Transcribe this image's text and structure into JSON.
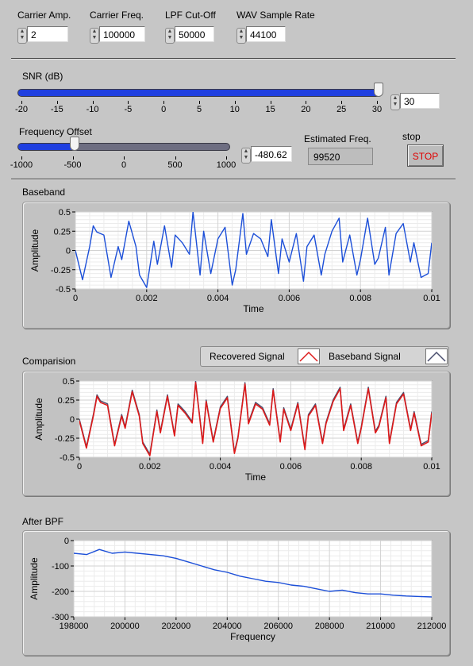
{
  "controls": [
    {
      "label": "Carrier Amp.",
      "value": "2"
    },
    {
      "label": "Carrier Freq.",
      "value": "100000"
    },
    {
      "label": "LPF Cut-Off",
      "value": "50000"
    },
    {
      "label": "WAV Sample Rate",
      "value": "44100"
    }
  ],
  "snr": {
    "label": "SNR (dB)",
    "value": "30",
    "min": -20,
    "max": 30,
    "current": 30,
    "ticks": [
      "-20",
      "-15",
      "-10",
      "-5",
      "0",
      "5",
      "10",
      "15",
      "20",
      "25",
      "30"
    ]
  },
  "freq_offset": {
    "label": "Frequency Offset",
    "value": "-480.62",
    "min": -1000,
    "max": 1000,
    "current": -480.62,
    "ticks": [
      "-1000",
      "-500",
      "0",
      "500",
      "1000"
    ]
  },
  "estimated": {
    "label": "Estimated Freq.",
    "value": "99520"
  },
  "stop": {
    "label": "stop",
    "button": "STOP"
  },
  "colors": {
    "signal": "#1c4fd8",
    "recovered": "#dd1a1a",
    "baseband": "#4a4e6e",
    "slider": "#1f3fe0"
  },
  "chart_data": [
    {
      "type": "line",
      "title": "Baseband",
      "xlabel": "Time",
      "ylabel": "Amplitude",
      "xlim": [
        0,
        0.01
      ],
      "ylim": [
        -0.5,
        0.5
      ],
      "xticks": [
        "0",
        "0.002",
        "0.004",
        "0.006",
        "0.008",
        "0.01"
      ],
      "yticks": [
        "0.5",
        "0.25",
        "0",
        "-0.25",
        "-0.5"
      ],
      "grid": true,
      "series": [
        {
          "x": [
            0,
            0.0002,
            0.0004,
            0.0005,
            0.0006,
            0.0008,
            0.001,
            0.0012,
            0.0013,
            0.0015,
            0.0017,
            0.0018,
            0.002,
            0.0022,
            0.0023,
            0.0025,
            0.0027,
            0.0028,
            0.003,
            0.0032,
            0.0033,
            0.0035,
            0.0036,
            0.0038,
            0.004,
            0.0042,
            0.0044,
            0.0045,
            0.0047,
            0.0048,
            0.005,
            0.0052,
            0.0054,
            0.0055,
            0.0057,
            0.0058,
            0.006,
            0.0062,
            0.0064,
            0.0065,
            0.0067,
            0.0069,
            0.007,
            0.0072,
            0.0074,
            0.0075,
            0.0077,
            0.0079,
            0.008,
            0.0082,
            0.0084,
            0.0085,
            0.0087,
            0.0088,
            0.009,
            0.0092,
            0.0094,
            0.0095,
            0.0097,
            0.0099,
            0.01
          ],
          "y": [
            0,
            -0.38,
            0.05,
            0.32,
            0.24,
            0.2,
            -0.35,
            0.05,
            -0.12,
            0.38,
            0.05,
            -0.32,
            -0.48,
            0.12,
            -0.18,
            0.32,
            -0.22,
            0.2,
            0.1,
            -0.05,
            0.5,
            -0.32,
            0.25,
            -0.3,
            0.15,
            0.3,
            -0.45,
            -0.25,
            0.48,
            -0.05,
            0.22,
            0.15,
            -0.08,
            0.4,
            -0.3,
            0.15,
            -0.15,
            0.22,
            -0.4,
            0.05,
            0.2,
            -0.32,
            -0.05,
            0.25,
            0.42,
            -0.15,
            0.2,
            -0.32,
            -0.12,
            0.42,
            -0.18,
            -0.1,
            0.3,
            -0.32,
            0.22,
            0.35,
            -0.15,
            0.1,
            -0.35,
            -0.3,
            0.1
          ]
        }
      ]
    },
    {
      "type": "line",
      "title": "Comparision",
      "xlabel": "Time",
      "ylabel": "Amplitude",
      "xlim": [
        0,
        0.01
      ],
      "ylim": [
        -0.5,
        0.5
      ],
      "xticks": [
        "0",
        "0.002",
        "0.004",
        "0.006",
        "0.008",
        "0.01"
      ],
      "yticks": [
        "0.5",
        "0.25",
        "0",
        "-0.25",
        "-0.5"
      ],
      "grid": true,
      "legend": "top-right",
      "series": [
        {
          "name": "Recovered Signal",
          "x": [
            0,
            0.0002,
            0.0004,
            0.0005,
            0.0006,
            0.0008,
            0.001,
            0.0012,
            0.0013,
            0.0015,
            0.0017,
            0.0018,
            0.002,
            0.0022,
            0.0023,
            0.0025,
            0.0027,
            0.0028,
            0.003,
            0.0032,
            0.0033,
            0.0035,
            0.0036,
            0.0038,
            0.004,
            0.0042,
            0.0044,
            0.0045,
            0.0047,
            0.0048,
            0.005,
            0.0052,
            0.0054,
            0.0055,
            0.0057,
            0.0058,
            0.006,
            0.0062,
            0.0064,
            0.0065,
            0.0067,
            0.0069,
            0.007,
            0.0072,
            0.0074,
            0.0075,
            0.0077,
            0.0079,
            0.008,
            0.0082,
            0.0084,
            0.0085,
            0.0087,
            0.0088,
            0.009,
            0.0092,
            0.0094,
            0.0095,
            0.0097,
            0.0099,
            0.01
          ],
          "y": [
            -0.02,
            -0.38,
            0.05,
            0.3,
            0.22,
            0.18,
            -0.35,
            0.04,
            -0.12,
            0.36,
            0.04,
            -0.32,
            -0.48,
            0.1,
            -0.18,
            0.3,
            -0.22,
            0.18,
            0.08,
            -0.05,
            0.48,
            -0.32,
            0.23,
            -0.3,
            0.14,
            0.28,
            -0.45,
            -0.25,
            0.46,
            -0.06,
            0.2,
            0.13,
            -0.08,
            0.38,
            -0.3,
            0.13,
            -0.15,
            0.2,
            -0.4,
            0.04,
            0.18,
            -0.32,
            -0.06,
            0.23,
            0.4,
            -0.15,
            0.18,
            -0.32,
            -0.12,
            0.4,
            -0.18,
            -0.1,
            0.28,
            -0.32,
            0.2,
            0.33,
            -0.15,
            0.08,
            -0.35,
            -0.3,
            0.08
          ]
        },
        {
          "name": "Baseband Signal",
          "x": [
            0,
            0.0002,
            0.0004,
            0.0005,
            0.0006,
            0.0008,
            0.001,
            0.0012,
            0.0013,
            0.0015,
            0.0017,
            0.0018,
            0.002,
            0.0022,
            0.0023,
            0.0025,
            0.0027,
            0.0028,
            0.003,
            0.0032,
            0.0033,
            0.0035,
            0.0036,
            0.0038,
            0.004,
            0.0042,
            0.0044,
            0.0045,
            0.0047,
            0.0048,
            0.005,
            0.0052,
            0.0054,
            0.0055,
            0.0057,
            0.0058,
            0.006,
            0.0062,
            0.0064,
            0.0065,
            0.0067,
            0.0069,
            0.007,
            0.0072,
            0.0074,
            0.0075,
            0.0077,
            0.0079,
            0.008,
            0.0082,
            0.0084,
            0.0085,
            0.0087,
            0.0088,
            0.009,
            0.0092,
            0.0094,
            0.0095,
            0.0097,
            0.0099,
            0.01
          ],
          "y": [
            0,
            -0.36,
            0.07,
            0.32,
            0.24,
            0.2,
            -0.33,
            0.06,
            -0.1,
            0.38,
            0.06,
            -0.3,
            -0.46,
            0.12,
            -0.16,
            0.32,
            -0.2,
            0.2,
            0.1,
            -0.03,
            0.5,
            -0.3,
            0.25,
            -0.28,
            0.16,
            0.3,
            -0.43,
            -0.23,
            0.48,
            -0.04,
            0.22,
            0.15,
            -0.06,
            0.4,
            -0.28,
            0.15,
            -0.13,
            0.22,
            -0.38,
            0.06,
            0.2,
            -0.3,
            -0.04,
            0.25,
            0.42,
            -0.13,
            0.2,
            -0.3,
            -0.1,
            0.42,
            -0.16,
            -0.08,
            0.3,
            -0.3,
            0.22,
            0.35,
            -0.13,
            0.1,
            -0.33,
            -0.28,
            0.1
          ]
        }
      ]
    },
    {
      "type": "line",
      "title": "After BPF",
      "xlabel": "Frequency",
      "ylabel": "Amplitude",
      "xlim": [
        198000,
        212000
      ],
      "ylim": [
        -300,
        0
      ],
      "xticks": [
        "198000",
        "200000",
        "202000",
        "204000",
        "206000",
        "208000",
        "210000",
        "212000"
      ],
      "yticks": [
        "0",
        "-100",
        "-200",
        "-300"
      ],
      "grid": true,
      "series": [
        {
          "x": [
            198000,
            198500,
            199000,
            199500,
            200000,
            200500,
            201000,
            201500,
            202000,
            202500,
            203000,
            203500,
            204000,
            204500,
            205000,
            205500,
            206000,
            206500,
            207000,
            207500,
            208000,
            208500,
            209000,
            209500,
            210000,
            210500,
            211000,
            211500,
            212000
          ],
          "y": [
            -50,
            -55,
            -35,
            -50,
            -45,
            -50,
            -55,
            -60,
            -70,
            -85,
            -100,
            -115,
            -125,
            -140,
            -150,
            -160,
            -165,
            -175,
            -180,
            -190,
            -200,
            -195,
            -205,
            -210,
            -210,
            -215,
            -218,
            -220,
            -222
          ]
        }
      ]
    }
  ]
}
